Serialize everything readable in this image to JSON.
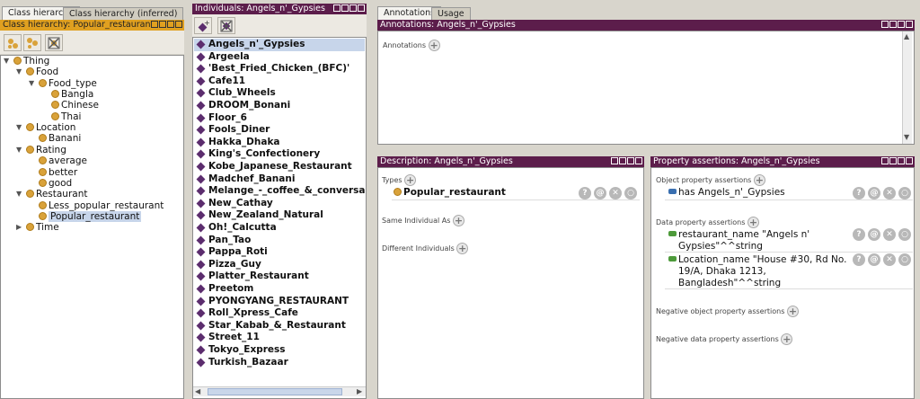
{
  "left": {
    "tabs": [
      "Class hierarchy",
      "Class hierarchy (inferred)"
    ],
    "title": "Class hierarchy: Popular_restaurant",
    "tree": [
      {
        "label": "Thing",
        "depth": 0,
        "twisty": "▼"
      },
      {
        "label": "Food",
        "depth": 1,
        "twisty": "▼"
      },
      {
        "label": "Food_type",
        "depth": 2,
        "twisty": "▼"
      },
      {
        "label": "Bangla",
        "depth": 3,
        "twisty": ""
      },
      {
        "label": "Chinese",
        "depth": 3,
        "twisty": ""
      },
      {
        "label": "Thai",
        "depth": 3,
        "twisty": ""
      },
      {
        "label": "Location",
        "depth": 1,
        "twisty": "▼"
      },
      {
        "label": "Banani",
        "depth": 2,
        "twisty": ""
      },
      {
        "label": "Rating",
        "depth": 1,
        "twisty": "▼"
      },
      {
        "label": "average",
        "depth": 2,
        "twisty": ""
      },
      {
        "label": "better",
        "depth": 2,
        "twisty": ""
      },
      {
        "label": "good",
        "depth": 2,
        "twisty": ""
      },
      {
        "label": "Restaurant",
        "depth": 1,
        "twisty": "▼"
      },
      {
        "label": "Less_popular_restaurant",
        "depth": 2,
        "twisty": ""
      },
      {
        "label": "Popular_restaurant",
        "depth": 2,
        "twisty": "",
        "selected": true
      },
      {
        "label": "Time",
        "depth": 1,
        "twisty": "▶"
      }
    ]
  },
  "individuals": {
    "title": "Individuals: Angels_n'_Gypsies",
    "items": [
      "Angels_n'_Gypsies",
      "Argeela",
      "'Best_Fried_Chicken_(BFC)'",
      "Cafe11",
      "Club_Wheels",
      "DROOM_Bonani",
      "Floor_6",
      "Fools_Diner",
      "Hakka_Dhaka",
      "King's_Confectionery",
      "Kobe_Japanese_Restaurant",
      "Madchef_Banani",
      "Melange_-_coffee_&_conversation",
      "New_Cathay",
      "New_Zealand_Natural",
      "Oh!_Calcutta",
      "Pan_Tao",
      "Pappa_Roti",
      "Pizza_Guy",
      "Platter_Restaurant",
      "Preetom",
      "PYONGYANG_RESTAURANT",
      "Roll_Xpress_Cafe",
      "Star_Kabab_&_Restaurant",
      "Street_11",
      "Tokyo_Express",
      "Turkish_Bazaar"
    ]
  },
  "right_tabs": [
    "Annotations",
    "Usage"
  ],
  "annotations": {
    "title": "Annotations: Angels_n'_Gypsies",
    "label": "Annotations"
  },
  "description": {
    "title": "Description: Angels_n'_Gypsies",
    "types_label": "Types",
    "type_value": "Popular_restaurant",
    "same_label": "Same Individual As",
    "different_label": "Different Individuals"
  },
  "property": {
    "title": "Property assertions: Angels_n'_Gypsies",
    "obj_label": "Object property assertions",
    "obj_entry": "has  Angels_n'_Gypsies",
    "data_label": "Data property assertions",
    "data1_line1": "restaurant_name  \"Angels n'",
    "data1_line2": "Gypsies\"^^string",
    "data2_line1": "Location_name  \"House #30, Rd No.",
    "data2_line2": "19/A, Dhaka 1213,",
    "data2_line3": "Bangladesh\"^^string",
    "neg_obj_label": "Negative object property assertions",
    "neg_data_label": "Negative data property assertions"
  },
  "colors": {
    "header": "#5c1d4b",
    "header_gold": "#e0a020",
    "class_dot": "#d9a23a",
    "individual": "#5c2d6e",
    "selection": "#c7d5ea"
  }
}
